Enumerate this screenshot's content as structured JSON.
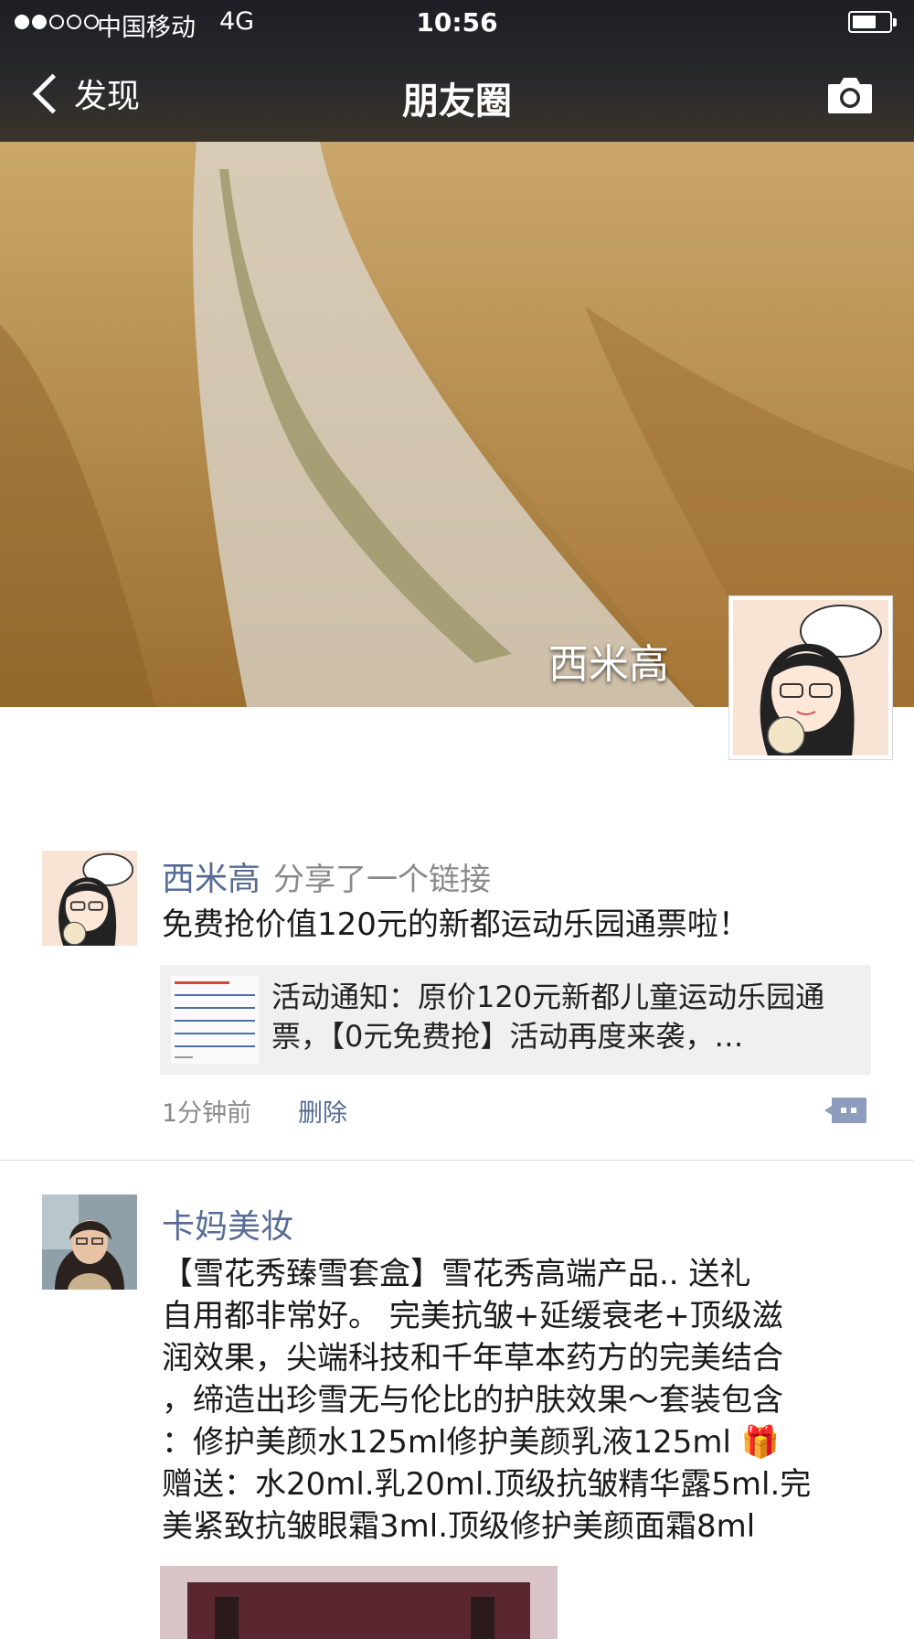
{
  "status_bar": {
    "carrier": "中国移动",
    "network": "4G",
    "time": "10:56",
    "signal_bars": 2,
    "signal_total": 5,
    "battery_level": 0.65
  },
  "nav": {
    "back_label": "发现",
    "title": "朋友圈",
    "camera_icon": "camera-icon"
  },
  "cover": {
    "profile_name": "西米高"
  },
  "feed": {
    "posts": [
      {
        "author": "西米高",
        "action": "分享了一个链接",
        "text": "免费抢价值120元的新都运动乐园通票啦！",
        "link_title": "活动通知：原价120元新都儿童运动乐园通票，【0元免费抢】活动再度来袭，…",
        "time": "1分钟前",
        "delete_label": "删除"
      },
      {
        "author": "卡妈美妆",
        "text": "【雪花秀臻雪套盒】雪花秀高端产品..   送礼\n自用都非常好。 完美抗皱+延缓衰老+顶级滋\n润效果，尖端科技和千年草本药方的完美结合\n，缔造出珍雪无与伦比的护肤效果～套装包含\n：修护美颜水125ml修护美颜乳液125ml 🎁\n赠送：水20ml.乳20ml.顶级抗皱精华露5ml.完\n美紧致抗皱眼霜3ml.顶级修护美颜面霜8ml"
      }
    ]
  },
  "colors": {
    "name_link": "#576b95",
    "nav_bg": "#26272b",
    "link_card_bg": "#f0f0f0"
  }
}
